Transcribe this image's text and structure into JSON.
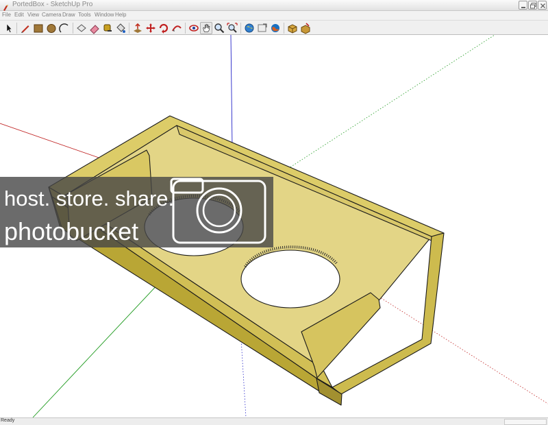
{
  "window": {
    "title": "PortedBox - SketchUp Pro"
  },
  "menu": {
    "items": [
      {
        "label": "File"
      },
      {
        "label": "Edit"
      },
      {
        "label": "View"
      },
      {
        "label": "Camera"
      },
      {
        "label": "Draw"
      },
      {
        "label": "Tools"
      },
      {
        "label": "Window"
      },
      {
        "label": "Help"
      }
    ]
  },
  "toolbar": {
    "tools": [
      {
        "name": "select-tool",
        "icon": "arrow-cursor-icon"
      },
      {
        "name": "pencil-tool",
        "icon": "pencil-icon"
      },
      {
        "name": "rectangle-tool",
        "icon": "rectangle-icon"
      },
      {
        "name": "circle-tool",
        "icon": "circle-icon"
      },
      {
        "name": "arc-tool",
        "icon": "arc-icon"
      },
      {
        "name": "make-component-tool",
        "icon": "component-icon"
      },
      {
        "name": "eraser-tool",
        "icon": "eraser-icon"
      },
      {
        "name": "tape-measure-tool",
        "icon": "tape-measure-icon"
      },
      {
        "name": "paint-bucket-tool",
        "icon": "paint-bucket-icon"
      },
      {
        "name": "push-pull-tool",
        "icon": "push-pull-icon"
      },
      {
        "name": "move-tool",
        "icon": "move-icon"
      },
      {
        "name": "rotate-tool",
        "icon": "rotate-icon"
      },
      {
        "name": "follow-me-tool",
        "icon": "follow-me-icon"
      },
      {
        "name": "orbit-tool",
        "icon": "orbit-icon"
      },
      {
        "name": "pan-tool",
        "icon": "hand-icon"
      },
      {
        "name": "zoom-tool",
        "icon": "magnifier-icon"
      },
      {
        "name": "zoom-extents-tool",
        "icon": "zoom-extents-icon"
      },
      {
        "name": "get-models-tool",
        "icon": "globe-icon"
      },
      {
        "name": "share-model-tool",
        "icon": "share-model-icon"
      },
      {
        "name": "google-earth-tool",
        "icon": "earth-icon"
      },
      {
        "name": "get-component-tool",
        "icon": "component-box-icon"
      },
      {
        "name": "extension-warehouse-tool",
        "icon": "warehouse-icon"
      }
    ]
  },
  "watermark": {
    "line1": "host. store. share.",
    "line2": "photobucket"
  },
  "colors": {
    "wood_top": "#dccc68",
    "wood_side": "#b9a635",
    "wood_edge": "#c7b444",
    "wood_inner": "#e6d98a",
    "axis_red": "#c02424",
    "axis_green": "#1e9a1e",
    "axis_blue": "#2424c8",
    "watermark_bg": "rgba(70,70,70,0.80)"
  },
  "status": {
    "text": "Ready"
  }
}
